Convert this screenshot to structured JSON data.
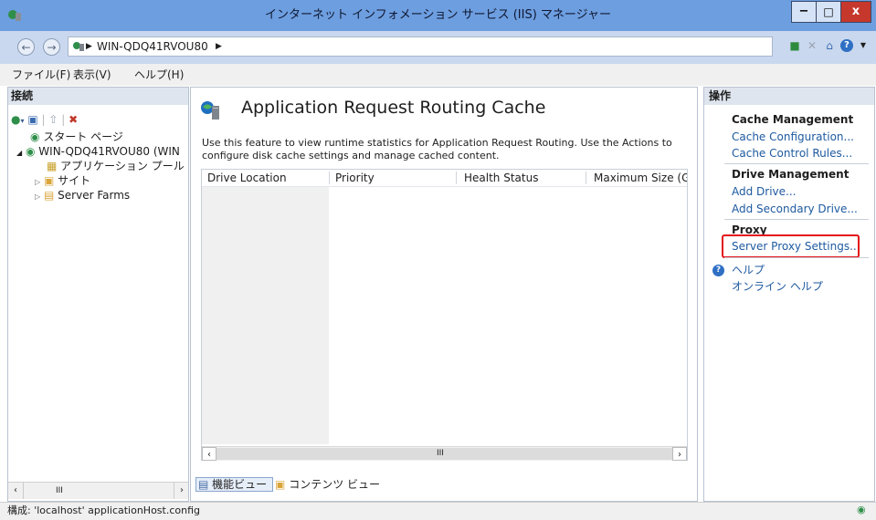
{
  "window": {
    "title": "インターネット インフォメーション サービス (IIS) マネージャー",
    "minimize": "−",
    "maximize": "□",
    "close": "x"
  },
  "address": {
    "path": "WIN-QDQ41RVOU80",
    "back": "←",
    "forward": "→"
  },
  "menu": [
    "ファイル(F)",
    "表示(V)",
    "ヘルプ(H)"
  ],
  "connections": {
    "header": "接続",
    "tree": [
      {
        "label": "スタート ページ"
      },
      {
        "label": "WIN-QDQ41RVOU80 (WIN"
      },
      {
        "label": "アプリケーション プール"
      },
      {
        "label": "サイト"
      },
      {
        "label": "Server Farms"
      }
    ],
    "scroll_thumb": "III"
  },
  "main": {
    "title": "Application Request Routing Cache",
    "description": "Use this feature to view runtime statistics for Application Request Routing.  Use the Actions to configure disk cache settings and manage cached content.",
    "columns": [
      "Drive Location",
      "Priority",
      "Health Status",
      "Maximum Size (GE"
    ],
    "hscroll_thumb": "III",
    "tabs": [
      "機能ビュー",
      "コンテンツ ビュー"
    ]
  },
  "actions": {
    "header": "操作",
    "groups": [
      {
        "title": "Cache Management",
        "links": [
          "Cache Configuration...",
          "Cache Control Rules..."
        ]
      },
      {
        "title": "Drive Management",
        "links": [
          "Add Drive...",
          "Add Secondary Drive..."
        ]
      },
      {
        "title": "Proxy",
        "links": [
          "Server Proxy Settings..."
        ]
      }
    ],
    "help": "ヘルプ",
    "online_help": "オンライン ヘルプ"
  },
  "status": {
    "text": "構成: 'localhost' applicationHost.config"
  },
  "colors": {
    "titlebar": "#6d9ee0",
    "link": "#1e5aa0",
    "highlight": "#e3121a"
  }
}
